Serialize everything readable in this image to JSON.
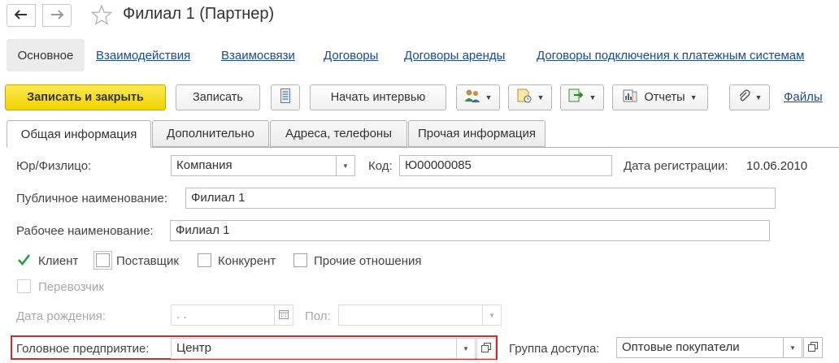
{
  "header": {
    "title": "Филиал 1 (Партнер)",
    "icons": [
      "arrow-left-icon",
      "arrow-right-icon",
      "star-icon"
    ]
  },
  "nav_links": {
    "active": "Основное",
    "items": [
      "Взаимодействия",
      "Взаимосвязи",
      "Договоры",
      "Договоры аренды",
      "Договоры подключения к платежным системам"
    ]
  },
  "toolbar": {
    "save_close": "Записать и закрыть",
    "save": "Записать",
    "start_interview": "Начать интервью",
    "reports": "Отчеты",
    "files": "Файлы"
  },
  "tabs": [
    "Общая информация",
    "Дополнительно",
    "Адреса, телефоны",
    "Прочая информация"
  ],
  "form": {
    "legal_type_label": "Юр/Физлицо:",
    "legal_type_value": "Компания",
    "code_label": "Код:",
    "code_value": "Ю00000085",
    "reg_date_label": "Дата регистрации:",
    "reg_date_value": "10.06.2010",
    "public_name_label": "Публичное наименование:",
    "public_name_value": "Филиал 1",
    "working_name_label": "Рабочее наименование:",
    "working_name_value": "Филиал 1",
    "checkboxes": {
      "client": {
        "label": "Клиент",
        "checked": true
      },
      "supplier": {
        "label": "Поставщик",
        "checked": false
      },
      "competitor": {
        "label": "Конкурент",
        "checked": false
      },
      "other": {
        "label": "Прочие отношения",
        "checked": false
      },
      "carrier": {
        "label": "Перевозчик",
        "checked": false,
        "disabled": true
      }
    },
    "birth_date_label": "Дата рождения:",
    "birth_date_value": " .  .",
    "gender_label": "Пол:",
    "gender_value": "",
    "head_company_label": "Головное предприятие:",
    "head_company_value": "Центр",
    "access_group_label": "Группа доступа:",
    "access_group_value": "Оптовые покупатели"
  },
  "colors": {
    "primary_button": "#f2d300",
    "link": "#1b4a9b",
    "highlight_border": "#d22b2b",
    "checkmark": "#2a9d3a"
  }
}
